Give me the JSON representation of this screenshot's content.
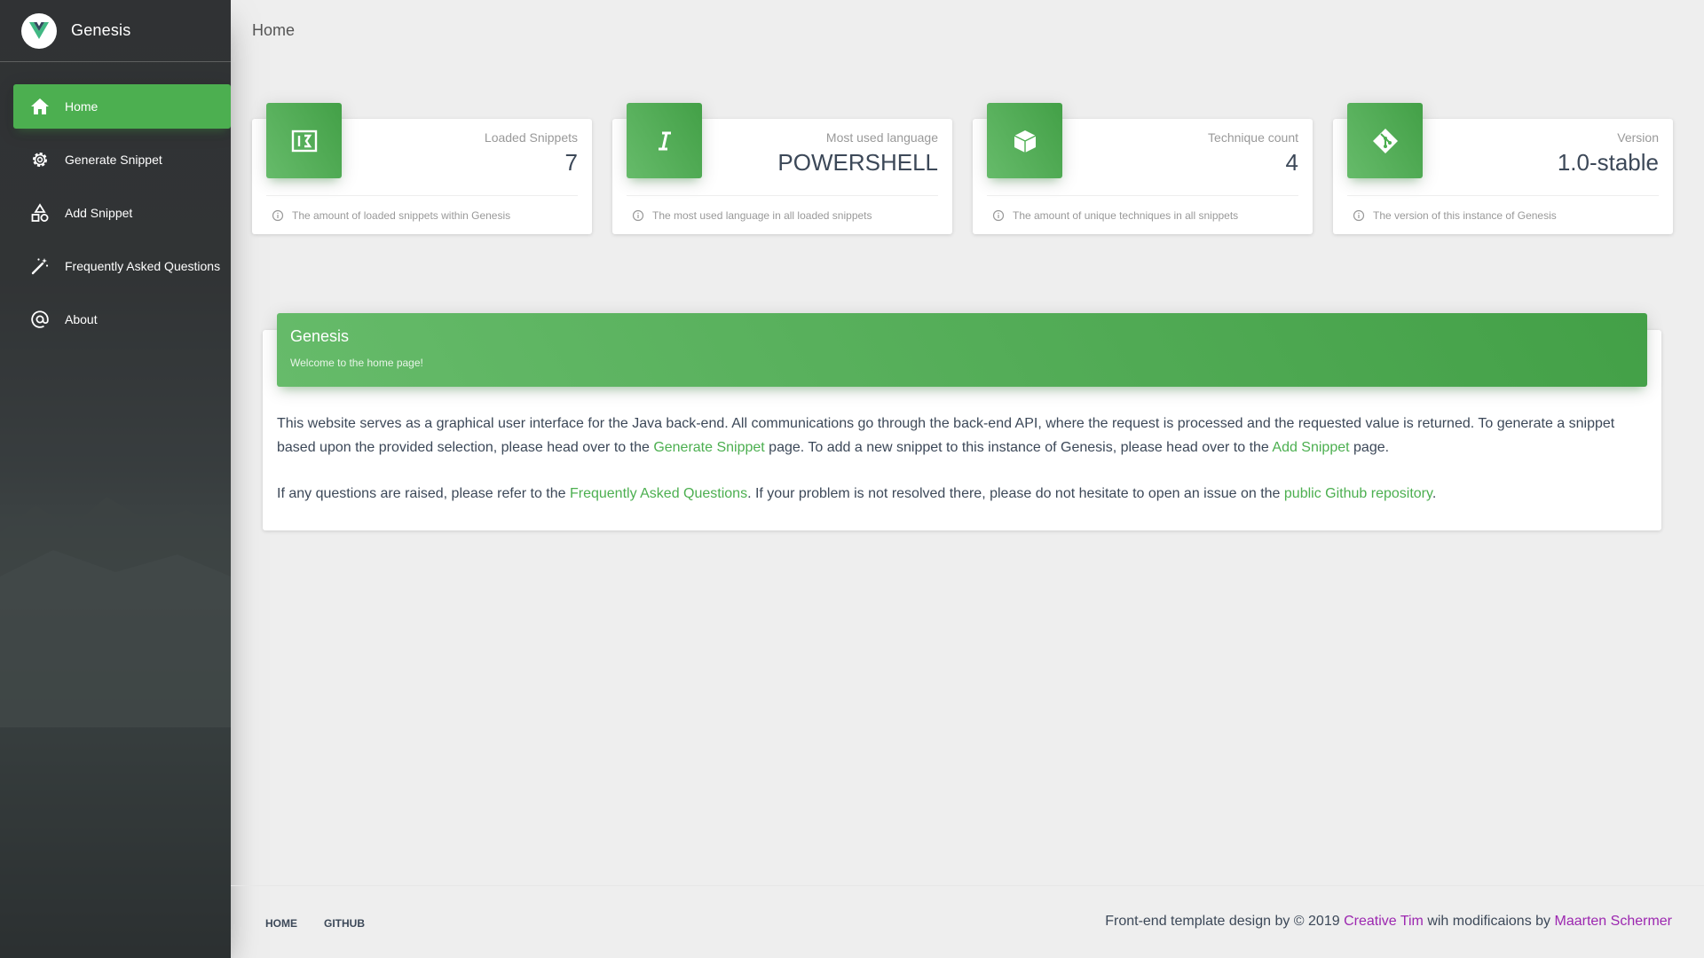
{
  "app": {
    "name": "Genesis"
  },
  "sidebar": {
    "items": [
      {
        "label": "Home",
        "icon": "home-icon",
        "active": true
      },
      {
        "label": "Generate Snippet",
        "icon": "settings-icon"
      },
      {
        "label": "Add Snippet",
        "icon": "shapes-icon"
      },
      {
        "label": "Frequently Asked Questions",
        "icon": "magic-wand-icon"
      },
      {
        "label": "About",
        "icon": "at-sign-icon"
      }
    ]
  },
  "header": {
    "title": "Home"
  },
  "stats": [
    {
      "category": "Loaded Snippets",
      "value": "7",
      "footer": "The amount of loaded snippets within Genesis",
      "icon": "code-snippet-icon"
    },
    {
      "category": "Most used language",
      "value": "POWERSHELL",
      "footer": "The most used language in all loaded snippets",
      "icon": "italic-icon"
    },
    {
      "category": "Technique count",
      "value": "4",
      "footer": "The amount of unique techniques in all snippets",
      "icon": "box-icon"
    },
    {
      "category": "Version",
      "value": "1.0-stable",
      "footer": "The version of this instance of Genesis",
      "icon": "git-icon"
    }
  ],
  "home_card": {
    "title": "Genesis",
    "subtitle": "Welcome to the home page!",
    "p1_a": "This website serves as a graphical user interface for the Java back-end. All communications go through the back-end API, where the request is processed and the requested value is returned. To generate a snippet based upon the provided selection, please head over to the ",
    "p1_link1": "Generate Snippet",
    "p1_b": " page. To add a new snippet to this instance of Genesis, please head over to the ",
    "p1_link2": "Add Snippet",
    "p1_c": " page.",
    "p2_a": "If any questions are raised, please refer to the ",
    "p2_link1": "Frequently Asked Questions",
    "p2_b": ". If your problem is not resolved there, please do not hesitate to open an issue on the ",
    "p2_link2": "public Github repository",
    "p2_c": "."
  },
  "footer": {
    "links": [
      "HOME",
      "GITHUB"
    ],
    "copy_a": "Front-end template design by © 2019 ",
    "copy_link1": "Creative Tim",
    "copy_b": " wih modificaions by ",
    "copy_link2": "Maarten Schermer"
  },
  "colors": {
    "accent": "#4caf50",
    "footer_link": "#9c27b0"
  }
}
